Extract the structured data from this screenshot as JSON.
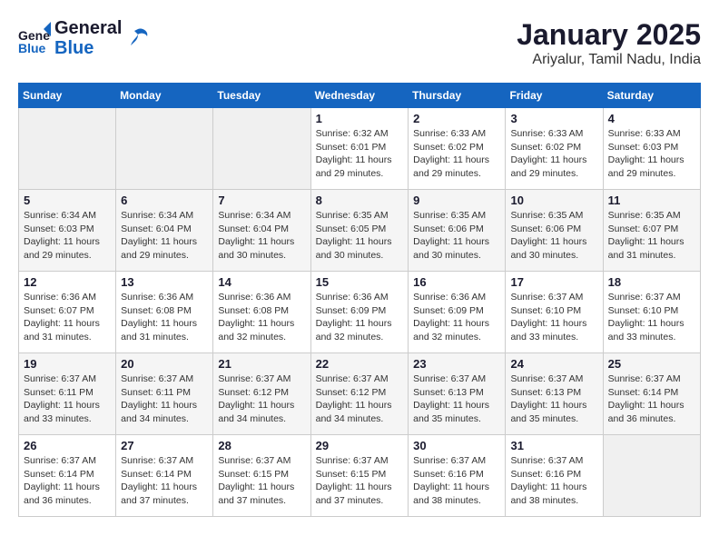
{
  "header": {
    "logo_general": "General",
    "logo_blue": "Blue",
    "title": "January 2025",
    "subtitle": "Ariyalur, Tamil Nadu, India"
  },
  "days_of_week": [
    "Sunday",
    "Monday",
    "Tuesday",
    "Wednesday",
    "Thursday",
    "Friday",
    "Saturday"
  ],
  "weeks": [
    [
      {
        "day": "",
        "sunrise": "",
        "sunset": "",
        "daylight": "",
        "empty": true
      },
      {
        "day": "",
        "sunrise": "",
        "sunset": "",
        "daylight": "",
        "empty": true
      },
      {
        "day": "",
        "sunrise": "",
        "sunset": "",
        "daylight": "",
        "empty": true
      },
      {
        "day": "1",
        "sunrise": "Sunrise: 6:32 AM",
        "sunset": "Sunset: 6:01 PM",
        "daylight": "Daylight: 11 hours and 29 minutes."
      },
      {
        "day": "2",
        "sunrise": "Sunrise: 6:33 AM",
        "sunset": "Sunset: 6:02 PM",
        "daylight": "Daylight: 11 hours and 29 minutes."
      },
      {
        "day": "3",
        "sunrise": "Sunrise: 6:33 AM",
        "sunset": "Sunset: 6:02 PM",
        "daylight": "Daylight: 11 hours and 29 minutes."
      },
      {
        "day": "4",
        "sunrise": "Sunrise: 6:33 AM",
        "sunset": "Sunset: 6:03 PM",
        "daylight": "Daylight: 11 hours and 29 minutes."
      }
    ],
    [
      {
        "day": "5",
        "sunrise": "Sunrise: 6:34 AM",
        "sunset": "Sunset: 6:03 PM",
        "daylight": "Daylight: 11 hours and 29 minutes."
      },
      {
        "day": "6",
        "sunrise": "Sunrise: 6:34 AM",
        "sunset": "Sunset: 6:04 PM",
        "daylight": "Daylight: 11 hours and 29 minutes."
      },
      {
        "day": "7",
        "sunrise": "Sunrise: 6:34 AM",
        "sunset": "Sunset: 6:04 PM",
        "daylight": "Daylight: 11 hours and 30 minutes."
      },
      {
        "day": "8",
        "sunrise": "Sunrise: 6:35 AM",
        "sunset": "Sunset: 6:05 PM",
        "daylight": "Daylight: 11 hours and 30 minutes."
      },
      {
        "day": "9",
        "sunrise": "Sunrise: 6:35 AM",
        "sunset": "Sunset: 6:06 PM",
        "daylight": "Daylight: 11 hours and 30 minutes."
      },
      {
        "day": "10",
        "sunrise": "Sunrise: 6:35 AM",
        "sunset": "Sunset: 6:06 PM",
        "daylight": "Daylight: 11 hours and 30 minutes."
      },
      {
        "day": "11",
        "sunrise": "Sunrise: 6:35 AM",
        "sunset": "Sunset: 6:07 PM",
        "daylight": "Daylight: 11 hours and 31 minutes."
      }
    ],
    [
      {
        "day": "12",
        "sunrise": "Sunrise: 6:36 AM",
        "sunset": "Sunset: 6:07 PM",
        "daylight": "Daylight: 11 hours and 31 minutes."
      },
      {
        "day": "13",
        "sunrise": "Sunrise: 6:36 AM",
        "sunset": "Sunset: 6:08 PM",
        "daylight": "Daylight: 11 hours and 31 minutes."
      },
      {
        "day": "14",
        "sunrise": "Sunrise: 6:36 AM",
        "sunset": "Sunset: 6:08 PM",
        "daylight": "Daylight: 11 hours and 32 minutes."
      },
      {
        "day": "15",
        "sunrise": "Sunrise: 6:36 AM",
        "sunset": "Sunset: 6:09 PM",
        "daylight": "Daylight: 11 hours and 32 minutes."
      },
      {
        "day": "16",
        "sunrise": "Sunrise: 6:36 AM",
        "sunset": "Sunset: 6:09 PM",
        "daylight": "Daylight: 11 hours and 32 minutes."
      },
      {
        "day": "17",
        "sunrise": "Sunrise: 6:37 AM",
        "sunset": "Sunset: 6:10 PM",
        "daylight": "Daylight: 11 hours and 33 minutes."
      },
      {
        "day": "18",
        "sunrise": "Sunrise: 6:37 AM",
        "sunset": "Sunset: 6:10 PM",
        "daylight": "Daylight: 11 hours and 33 minutes."
      }
    ],
    [
      {
        "day": "19",
        "sunrise": "Sunrise: 6:37 AM",
        "sunset": "Sunset: 6:11 PM",
        "daylight": "Daylight: 11 hours and 33 minutes."
      },
      {
        "day": "20",
        "sunrise": "Sunrise: 6:37 AM",
        "sunset": "Sunset: 6:11 PM",
        "daylight": "Daylight: 11 hours and 34 minutes."
      },
      {
        "day": "21",
        "sunrise": "Sunrise: 6:37 AM",
        "sunset": "Sunset: 6:12 PM",
        "daylight": "Daylight: 11 hours and 34 minutes."
      },
      {
        "day": "22",
        "sunrise": "Sunrise: 6:37 AM",
        "sunset": "Sunset: 6:12 PM",
        "daylight": "Daylight: 11 hours and 34 minutes."
      },
      {
        "day": "23",
        "sunrise": "Sunrise: 6:37 AM",
        "sunset": "Sunset: 6:13 PM",
        "daylight": "Daylight: 11 hours and 35 minutes."
      },
      {
        "day": "24",
        "sunrise": "Sunrise: 6:37 AM",
        "sunset": "Sunset: 6:13 PM",
        "daylight": "Daylight: 11 hours and 35 minutes."
      },
      {
        "day": "25",
        "sunrise": "Sunrise: 6:37 AM",
        "sunset": "Sunset: 6:14 PM",
        "daylight": "Daylight: 11 hours and 36 minutes."
      }
    ],
    [
      {
        "day": "26",
        "sunrise": "Sunrise: 6:37 AM",
        "sunset": "Sunset: 6:14 PM",
        "daylight": "Daylight: 11 hours and 36 minutes."
      },
      {
        "day": "27",
        "sunrise": "Sunrise: 6:37 AM",
        "sunset": "Sunset: 6:14 PM",
        "daylight": "Daylight: 11 hours and 37 minutes."
      },
      {
        "day": "28",
        "sunrise": "Sunrise: 6:37 AM",
        "sunset": "Sunset: 6:15 PM",
        "daylight": "Daylight: 11 hours and 37 minutes."
      },
      {
        "day": "29",
        "sunrise": "Sunrise: 6:37 AM",
        "sunset": "Sunset: 6:15 PM",
        "daylight": "Daylight: 11 hours and 37 minutes."
      },
      {
        "day": "30",
        "sunrise": "Sunrise: 6:37 AM",
        "sunset": "Sunset: 6:16 PM",
        "daylight": "Daylight: 11 hours and 38 minutes."
      },
      {
        "day": "31",
        "sunrise": "Sunrise: 6:37 AM",
        "sunset": "Sunset: 6:16 PM",
        "daylight": "Daylight: 11 hours and 38 minutes."
      },
      {
        "day": "",
        "sunrise": "",
        "sunset": "",
        "daylight": "",
        "empty": true
      }
    ]
  ]
}
